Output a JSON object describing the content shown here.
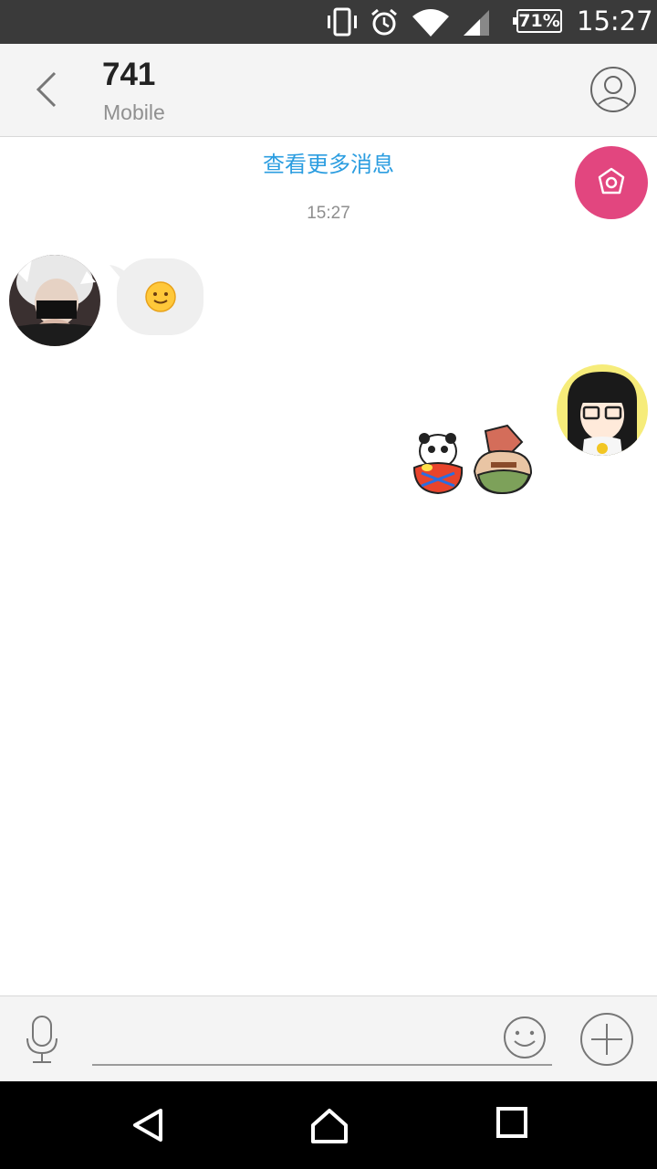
{
  "status_bar": {
    "battery": "71%",
    "time": "15:27",
    "icons": [
      "vibrate-icon",
      "alarm-icon",
      "wifi-icon",
      "signal-icon",
      "battery-icon"
    ]
  },
  "header": {
    "contact_name": "741",
    "contact_status": "Mobile",
    "icons": [
      "back-arrow-icon",
      "profile-icon"
    ]
  },
  "chat": {
    "load_more": "查看更多消息",
    "timestamp": "15:27",
    "messages": [
      {
        "direction": "incoming",
        "content": "smiley-emoji"
      },
      {
        "direction": "outgoing",
        "content": "sticker-panda-and-pig"
      }
    ],
    "floating_button_icon": "flower-icon"
  },
  "input_bar": {
    "text_value": "",
    "icons": [
      "microphone-icon",
      "emoji-icon",
      "plus-icon"
    ]
  },
  "nav_bar": {
    "icons": [
      "back-triangle-icon",
      "home-icon",
      "recents-icon"
    ]
  },
  "colors": {
    "accent": "#2b9de0",
    "float_button": "#e2467f",
    "header_bg": "#f4f4f4",
    "status_bar_bg": "#3a3a3a"
  }
}
